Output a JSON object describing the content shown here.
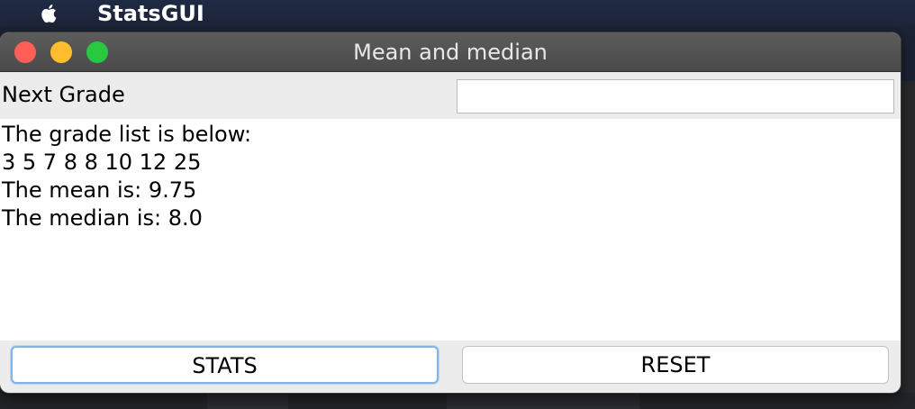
{
  "menubar": {
    "app_name": "StatsGUI",
    "icons": [
      "apple-icon"
    ]
  },
  "window": {
    "title": "Mean and median",
    "controls": [
      "close",
      "minimize",
      "maximize"
    ],
    "colors": {
      "close": "#ff5f57",
      "minimize": "#febc2e",
      "maximize": "#28c840"
    }
  },
  "grade": {
    "label": "Next Grade",
    "value": "",
    "placeholder": ""
  },
  "output": {
    "lines": [
      "The grade list is below:",
      "3 5 7 8 8 10 12 25",
      "The mean is: 9.75",
      "The median is: 8.0"
    ]
  },
  "buttons": {
    "stats_label": "STATS",
    "reset_label": "RESET"
  }
}
